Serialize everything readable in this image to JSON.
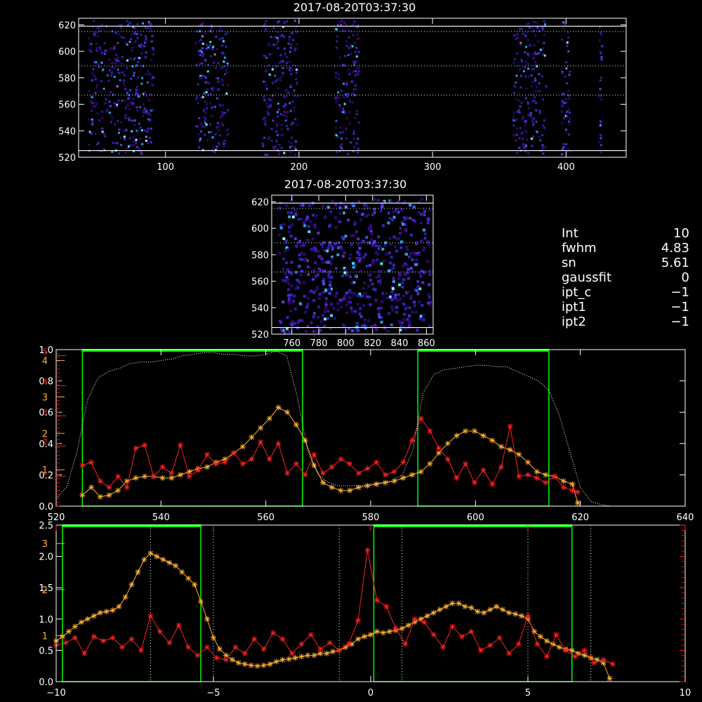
{
  "colors": {
    "background": "#000000",
    "axis": "#ffffff",
    "red": "#ff2020",
    "orange": "#ffb030",
    "green": "#00ff00",
    "dotted": "#ffffff",
    "guide": "#c8ffc8"
  },
  "top_image": {
    "title": "2017-08-20T03:37:30"
  },
  "zoom_image": {
    "title": "2017-08-20T03:37:30"
  },
  "params": [
    {
      "name": "Int",
      "value": "10"
    },
    {
      "name": "fwhm",
      "value": "4.83"
    },
    {
      "name": "sn",
      "value": "5.61"
    },
    {
      "name": "gaussfit",
      "value": "0"
    },
    {
      "name": "ipt_c",
      "value": "−1"
    },
    {
      "name": "ipt1",
      "value": "−1"
    },
    {
      "name": "ipt2",
      "value": "−1"
    }
  ],
  "chart_data": [
    {
      "type": "heatmap",
      "title": "2017-08-20T03:37:30",
      "xlim": [
        35,
        445
      ],
      "ylim": [
        520,
        625
      ],
      "x_ticks": [
        "100",
        "200",
        "300",
        "400"
      ],
      "y_ticks": [
        "520",
        "540",
        "560",
        "580",
        "600",
        "620"
      ],
      "bright_columns": [
        [
          42,
          92
        ],
        [
          122,
          148
        ],
        [
          172,
          200
        ],
        [
          226,
          246
        ],
        [
          360,
          386
        ],
        [
          396,
          404
        ],
        [
          424,
          428
        ]
      ],
      "white_lines_y": [
        525,
        619
      ],
      "green_dotted_y": [
        567,
        589,
        615
      ]
    },
    {
      "type": "heatmap",
      "title": "2017-08-20T03:37:30",
      "xlim": [
        745,
        865
      ],
      "ylim": [
        520,
        625
      ],
      "x_ticks": [
        "760",
        "780",
        "800",
        "820",
        "840",
        "860"
      ],
      "y_ticks": [
        "520",
        "540",
        "560",
        "580",
        "600",
        "620"
      ],
      "white_lines_y": [
        525,
        619
      ],
      "green_dotted_y": [
        567,
        589,
        615
      ]
    },
    {
      "type": "line",
      "xlim": [
        520,
        640
      ],
      "x_ticks": [
        "520",
        "540",
        "560",
        "580",
        "600",
        "620",
        "640"
      ],
      "y_ticks_white": [
        "0.0",
        "0.2",
        "0.4",
        "0.6",
        "0.8",
        "1.0"
      ],
      "y_ticks_orange": [
        "1",
        "2",
        "3",
        "4"
      ],
      "y_ticks_red": [
        "1",
        "2",
        "3",
        "4",
        "5"
      ],
      "green_boxes": [
        [
          525,
          567
        ],
        [
          589,
          614
        ]
      ],
      "series": [
        {
          "color": "orange",
          "x": [
            525,
            526.7,
            528.4,
            530.1,
            531.8,
            533.5,
            535.2,
            536.9,
            538.6,
            540.3,
            542,
            543.7,
            545.4,
            547.1,
            548.8,
            550.5,
            552.2,
            553.9,
            555.6,
            557.3,
            559,
            560.7,
            562.4,
            564.1,
            565.8,
            567.5,
            569.2,
            570.9,
            572.6,
            574.3,
            576,
            577.7,
            579.4,
            581.1,
            582.8,
            584.5,
            586.2,
            587.9,
            589.6,
            591.3,
            593,
            594.7,
            596.4,
            598.1,
            599.8,
            601.5,
            603.2,
            604.9,
            606.6,
            608.3,
            610,
            611.7,
            613.4,
            615.1,
            616.8,
            618.5,
            619.5
          ],
          "y": [
            0.07,
            0.12,
            0.06,
            0.07,
            0.1,
            0.16,
            0.18,
            0.19,
            0.19,
            0.18,
            0.18,
            0.2,
            0.22,
            0.24,
            0.25,
            0.28,
            0.3,
            0.34,
            0.38,
            0.44,
            0.5,
            0.56,
            0.63,
            0.6,
            0.52,
            0.42,
            0.26,
            0.15,
            0.12,
            0.1,
            0.1,
            0.12,
            0.13,
            0.14,
            0.15,
            0.16,
            0.18,
            0.2,
            0.22,
            0.27,
            0.34,
            0.4,
            0.45,
            0.48,
            0.48,
            0.45,
            0.42,
            0.38,
            0.36,
            0.33,
            0.28,
            0.22,
            0.2,
            0.19,
            0.16,
            0.14,
            0.02
          ]
        },
        {
          "color": "red",
          "x": [
            525,
            526.7,
            528.4,
            530.1,
            531.8,
            533.5,
            535.2,
            536.9,
            538.6,
            540.3,
            542,
            543.7,
            545.4,
            547.1,
            548.8,
            550.5,
            552.2,
            553.9,
            555.6,
            557.3,
            559,
            560.7,
            562.4,
            564.1,
            565.8,
            567.5,
            569.2,
            570.9,
            572.6,
            574.3,
            576,
            577.7,
            579.4,
            581.1,
            582.8,
            584.5,
            586.2,
            587.9,
            589.6,
            591.3,
            593,
            594.7,
            596.4,
            598.1,
            599.8,
            601.5,
            603.2,
            604.9,
            606.6,
            608.3,
            610,
            611.7,
            613.4,
            615.1,
            616.8,
            618.5,
            619.5
          ],
          "y": [
            0.26,
            0.28,
            0.16,
            0.12,
            0.19,
            0.12,
            0.37,
            0.39,
            0.19,
            0.25,
            0.21,
            0.39,
            0.19,
            0.23,
            0.33,
            0.27,
            0.28,
            0.34,
            0.27,
            0.3,
            0.41,
            0.3,
            0.4,
            0.21,
            0.27,
            0.2,
            0.33,
            0.21,
            0.25,
            0.3,
            0.27,
            0.21,
            0.24,
            0.28,
            0.2,
            0.22,
            0.28,
            0.42,
            0.56,
            0.48,
            0.37,
            0.3,
            0.18,
            0.27,
            0.15,
            0.23,
            0.14,
            0.25,
            0.51,
            0.19,
            0.2,
            0.18,
            0.15,
            0.19,
            0.12,
            0.1,
            0.09
          ]
        },
        {
          "color": "dotted",
          "x": [
            520,
            522,
            524,
            526,
            528,
            530,
            532,
            534,
            536,
            538,
            540,
            542,
            544,
            546,
            548,
            550,
            552,
            554,
            556,
            558,
            560,
            562,
            564,
            566,
            568,
            570,
            572,
            574,
            576,
            578,
            580,
            582,
            584,
            586,
            588,
            590,
            592,
            594,
            596,
            598,
            600,
            602,
            604,
            606,
            608,
            610,
            612,
            614,
            616,
            618,
            620,
            622,
            624,
            626,
            628,
            630,
            632,
            634,
            636,
            638,
            640
          ],
          "y": [
            0.05,
            0.12,
            0.35,
            0.68,
            0.82,
            0.86,
            0.88,
            0.91,
            0.92,
            0.92,
            0.93,
            0.94,
            0.96,
            0.97,
            0.98,
            0.98,
            0.97,
            0.97,
            0.96,
            0.96,
            0.97,
            0.99,
            0.96,
            0.7,
            0.35,
            0.2,
            0.15,
            0.13,
            0.13,
            0.13,
            0.14,
            0.15,
            0.16,
            0.2,
            0.35,
            0.72,
            0.84,
            0.87,
            0.88,
            0.89,
            0.9,
            0.9,
            0.89,
            0.89,
            0.86,
            0.83,
            0.8,
            0.74,
            0.58,
            0.35,
            0.12,
            0.03,
            0.01,
            0.0,
            0.0,
            0.0,
            0.0,
            0.0,
            0.0,
            0.0,
            0.0
          ]
        }
      ]
    },
    {
      "type": "line",
      "xlim": [
        -10,
        10
      ],
      "ylim": [
        0,
        2.5
      ],
      "x_ticks": [
        "−10",
        "−5",
        "0",
        "5",
        "10"
      ],
      "y_ticks_white": [
        "0.0",
        "0.5",
        "1.0",
        "1.5",
        "2.0",
        "2.5"
      ],
      "y_ticks_orange": [
        "1",
        "2",
        "3"
      ],
      "green_boxes": [
        [
          -9.8,
          -5.4
        ],
        [
          0.1,
          6.4
        ]
      ],
      "dotted_verticals": [
        -7.0,
        -5.0,
        -1.0,
        1.0,
        5.0,
        7.0
      ],
      "series": [
        {
          "color": "orange",
          "x": [
            -10,
            -9.8,
            -9.6,
            -9.4,
            -9.2,
            -9.0,
            -8.8,
            -8.6,
            -8.4,
            -8.2,
            -8.0,
            -7.8,
            -7.6,
            -7.4,
            -7.2,
            -7.0,
            -6.8,
            -6.6,
            -6.4,
            -6.2,
            -6.0,
            -5.8,
            -5.6,
            -5.4,
            -5.2,
            -5.0,
            -4.8,
            -4.6,
            -4.4,
            -4.2,
            -4.0,
            -3.8,
            -3.6,
            -3.4,
            -3.2,
            -3.0,
            -2.8,
            -2.6,
            -2.4,
            -2.2,
            -2.0,
            -1.8,
            -1.6,
            -1.4,
            -1.2,
            -1.0,
            -0.8,
            -0.6,
            -0.4,
            -0.2,
            0.0,
            0.2,
            0.4,
            0.6,
            0.8,
            1.0,
            1.2,
            1.4,
            1.6,
            1.8,
            2.0,
            2.2,
            2.4,
            2.6,
            2.8,
            3.0,
            3.2,
            3.4,
            3.6,
            3.8,
            4.0,
            4.2,
            4.4,
            4.6,
            4.8,
            5.0,
            5.2,
            5.4,
            5.6,
            5.8,
            6.0,
            6.2,
            6.4,
            6.6,
            6.8,
            7.0,
            7.2,
            7.4,
            7.6
          ],
          "y": [
            0.65,
            0.72,
            0.8,
            0.88,
            0.95,
            1.0,
            1.05,
            1.1,
            1.12,
            1.14,
            1.2,
            1.35,
            1.55,
            1.75,
            1.95,
            2.05,
            2.0,
            1.95,
            1.9,
            1.85,
            1.75,
            1.65,
            1.55,
            1.28,
            1.0,
            0.7,
            0.52,
            0.42,
            0.35,
            0.3,
            0.28,
            0.26,
            0.25,
            0.26,
            0.28,
            0.32,
            0.35,
            0.36,
            0.38,
            0.4,
            0.42,
            0.42,
            0.45,
            0.45,
            0.48,
            0.5,
            0.55,
            0.6,
            0.68,
            0.72,
            0.75,
            0.8,
            0.78,
            0.8,
            0.82,
            0.85,
            0.9,
            0.95,
            1.0,
            1.05,
            1.1,
            1.15,
            1.2,
            1.25,
            1.25,
            1.2,
            1.18,
            1.12,
            1.1,
            1.15,
            1.2,
            1.15,
            1.1,
            1.08,
            1.05,
            1.0,
            0.8,
            0.72,
            0.65,
            0.6,
            0.55,
            0.52,
            0.5,
            0.45,
            0.42,
            0.38,
            0.35,
            0.3,
            0.05
          ]
        },
        {
          "color": "red",
          "x": [
            -10,
            -9.7,
            -9.4,
            -9.1,
            -8.8,
            -8.5,
            -8.2,
            -7.9,
            -7.6,
            -7.3,
            -7.0,
            -6.7,
            -6.4,
            -6.1,
            -5.8,
            -5.5,
            -5.2,
            -4.9,
            -4.6,
            -4.3,
            -4.0,
            -3.7,
            -3.4,
            -3.1,
            -2.8,
            -2.5,
            -2.2,
            -1.9,
            -1.6,
            -1.3,
            -1.0,
            -0.7,
            -0.4,
            -0.1,
            0.2,
            0.5,
            0.8,
            1.1,
            1.4,
            1.7,
            2.0,
            2.3,
            2.6,
            2.9,
            3.2,
            3.5,
            3.8,
            4.1,
            4.4,
            4.7,
            5.0,
            5.3,
            5.6,
            5.9,
            6.2,
            6.5,
            6.8,
            7.1,
            7.4,
            7.7
          ],
          "y": [
            0.58,
            0.62,
            0.7,
            0.45,
            0.72,
            0.65,
            0.7,
            0.55,
            0.68,
            0.5,
            1.05,
            0.8,
            0.62,
            0.9,
            0.55,
            0.42,
            0.55,
            0.38,
            0.35,
            0.55,
            0.45,
            0.68,
            0.52,
            0.78,
            0.68,
            0.45,
            0.6,
            0.75,
            0.52,
            0.62,
            0.5,
            0.6,
            0.98,
            2.1,
            1.3,
            1.2,
            0.85,
            0.6,
            1.0,
            0.95,
            0.75,
            0.55,
            0.88,
            0.72,
            0.8,
            0.5,
            0.58,
            0.7,
            0.45,
            0.6,
            1.05,
            0.6,
            0.4,
            0.75,
            0.5,
            0.4,
            0.5,
            0.3,
            0.35,
            0.28
          ]
        }
      ]
    }
  ]
}
